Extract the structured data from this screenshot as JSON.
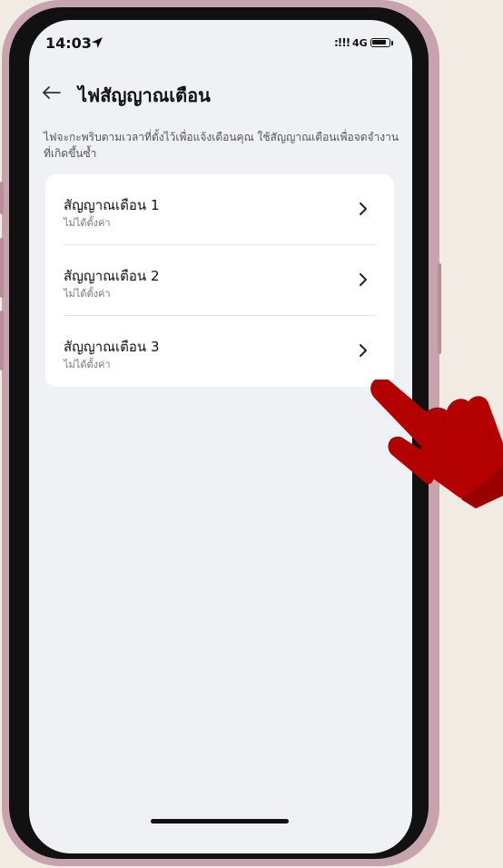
{
  "status_bar": {
    "time": "14:03",
    "signal": ":!!!",
    "network": "4G",
    "location_icon": "location-arrow-icon",
    "battery_icon": "battery-icon"
  },
  "header": {
    "back_icon": "back-arrow-icon",
    "title": "ไฟสัญญาณเตือน"
  },
  "description": "ไฟจะกะพริบตามเวลาที่ตั้งไว้เพื่อแจ้งเตือนคุณ ใช้สัญญาณเตือนเพื่อจดจำงานที่เกิดขึ้นซ้ำ",
  "alarms": [
    {
      "title": "สัญญาณเตือน 1",
      "subtitle": "ไม่ได้ตั้งค่า"
    },
    {
      "title": "สัญญาณเตือน 2",
      "subtitle": "ไม่ได้ตั้งค่า"
    },
    {
      "title": "สัญญาณเตือน 3",
      "subtitle": "ไม่ได้ตั้งค่า"
    }
  ],
  "colors": {
    "page_background": "#f1ebe4",
    "screen_background": "#f0f1f5",
    "card_background": "#ffffff",
    "hand_pointer": "#b30000"
  },
  "overlay": {
    "icon": "pointing-hand-icon"
  }
}
